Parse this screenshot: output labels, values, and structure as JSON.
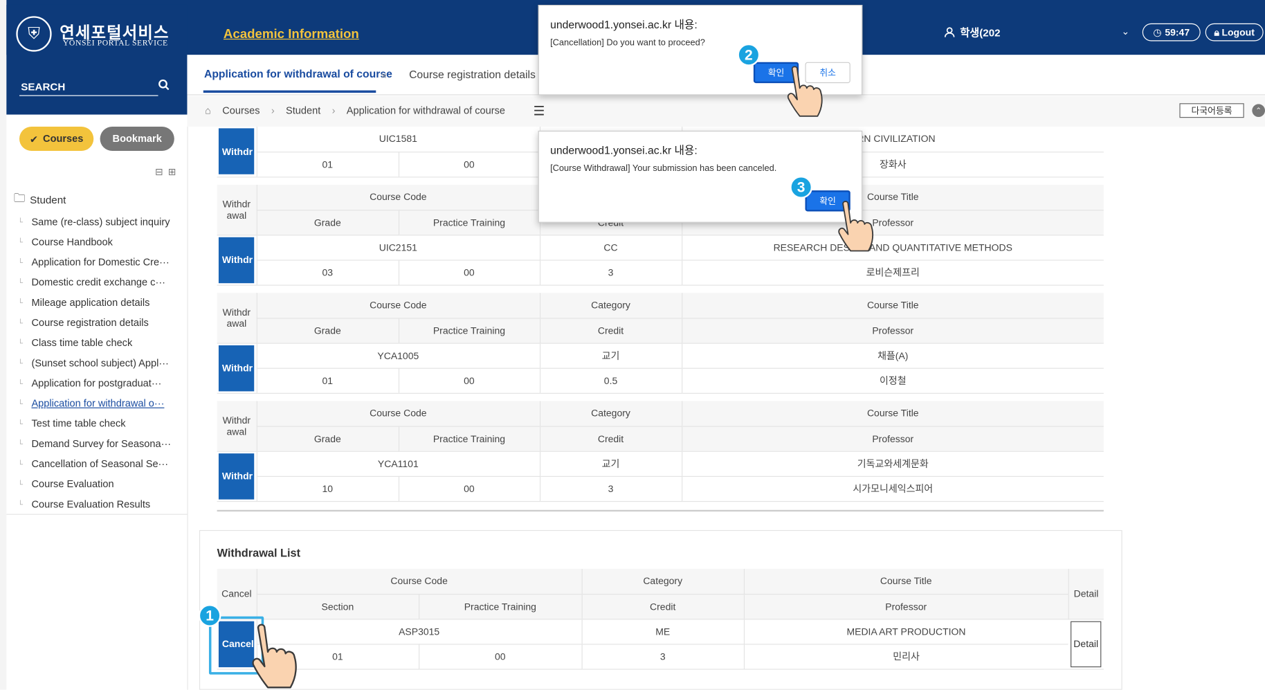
{
  "header": {
    "logo_ko": "연세포털서비스",
    "logo_en": "YONSEI PORTAL SERVICE",
    "search_label": "SEARCH",
    "title": "Academic Information",
    "user": "학생(202",
    "timer": "59:47",
    "logout": "Logout"
  },
  "tabs": [
    {
      "label": "Application for withdrawal of course",
      "active": true
    },
    {
      "label": "Course registration details",
      "active": false
    }
  ],
  "breadcrumb": [
    "Courses",
    "Student",
    "Application for withdrawal of course"
  ],
  "lang_button": "다국어등록",
  "sidebar": {
    "courses_button": "Courses",
    "bookmark_button": "Bookmark",
    "section": "Student",
    "items": [
      "Same (re-class) subject inquiry",
      "Course Handbook",
      "Application for Domestic Cre···",
      "Domestic credit exchange c···",
      "Mileage application details",
      "Course registration details",
      "Class time table check",
      "(Sunset school subject) Appl···",
      "Application for postgraduat···",
      "Application for withdrawal o···",
      "Test time table check",
      "Demand Survey for Seasona···",
      "Cancellation of Seasonal Se···",
      "Course Evaluation",
      "Course Evaluation Results"
    ],
    "active_index": 9
  },
  "course_headers": {
    "withdrawal": "Withdr awal",
    "course_code": "Course Code",
    "category": "Category",
    "course_title": "Course Title",
    "grade": "Grade",
    "practice": "Practice Training",
    "credit": "Credit",
    "professor": "Professor",
    "withdraw_button": "Withdr"
  },
  "courses": [
    {
      "code": "UIC1581",
      "category": "",
      "title": "ERN CIVILIZATION",
      "grade": "01",
      "practice": "00",
      "credit": "",
      "professor": "장화사"
    },
    {
      "code": "UIC2151",
      "category": "CC",
      "title": "RESEARCH DESIGN AND QUANTITATIVE METHODS",
      "grade": "03",
      "practice": "00",
      "credit": "3",
      "professor": "로비슨제프리"
    },
    {
      "code": "YCA1005",
      "category": "교기",
      "title": "채플(A)",
      "grade": "01",
      "practice": "00",
      "credit": "0.5",
      "professor": "이정철"
    },
    {
      "code": "YCA1101",
      "category": "교기",
      "title": "기독교와세계문화",
      "grade": "10",
      "practice": "00",
      "credit": "3",
      "professor": "시가모니세익스피어"
    }
  ],
  "withdrawal_list": {
    "title": "Withdrawal List",
    "headers": {
      "cancel": "Cancel",
      "course_code": "Course Code",
      "category": "Category",
      "course_title": "Course Title",
      "detail": "Detail",
      "section": "Section",
      "practice": "Practice Training",
      "credit": "Credit",
      "professor": "Professor"
    },
    "rows": [
      {
        "code": "ASP3015",
        "category": "ME",
        "title": "MEDIA ART PRODUCTION",
        "section": "01",
        "practice": "00",
        "credit": "3",
        "professor": "민리사",
        "cancel_button": "Cancel",
        "detail_button": "Detail"
      }
    ]
  },
  "dialogs": [
    {
      "title": "underwood1.yonsei.ac.kr 내용:",
      "message": "[Cancellation] Do you want to proceed?",
      "ok": "확인",
      "cancel": "취소"
    },
    {
      "title": "underwood1.yonsei.ac.kr 내용:",
      "message": "[Course Withdrawal] Your submission has been canceled.",
      "ok": "확인"
    }
  ],
  "steps": [
    "1",
    "2",
    "3"
  ],
  "colors": {
    "header": "#0d3a7a",
    "accent_yellow": "#f3c33c",
    "button_blue": "#1763b5",
    "badge": "#1aa3e0"
  }
}
